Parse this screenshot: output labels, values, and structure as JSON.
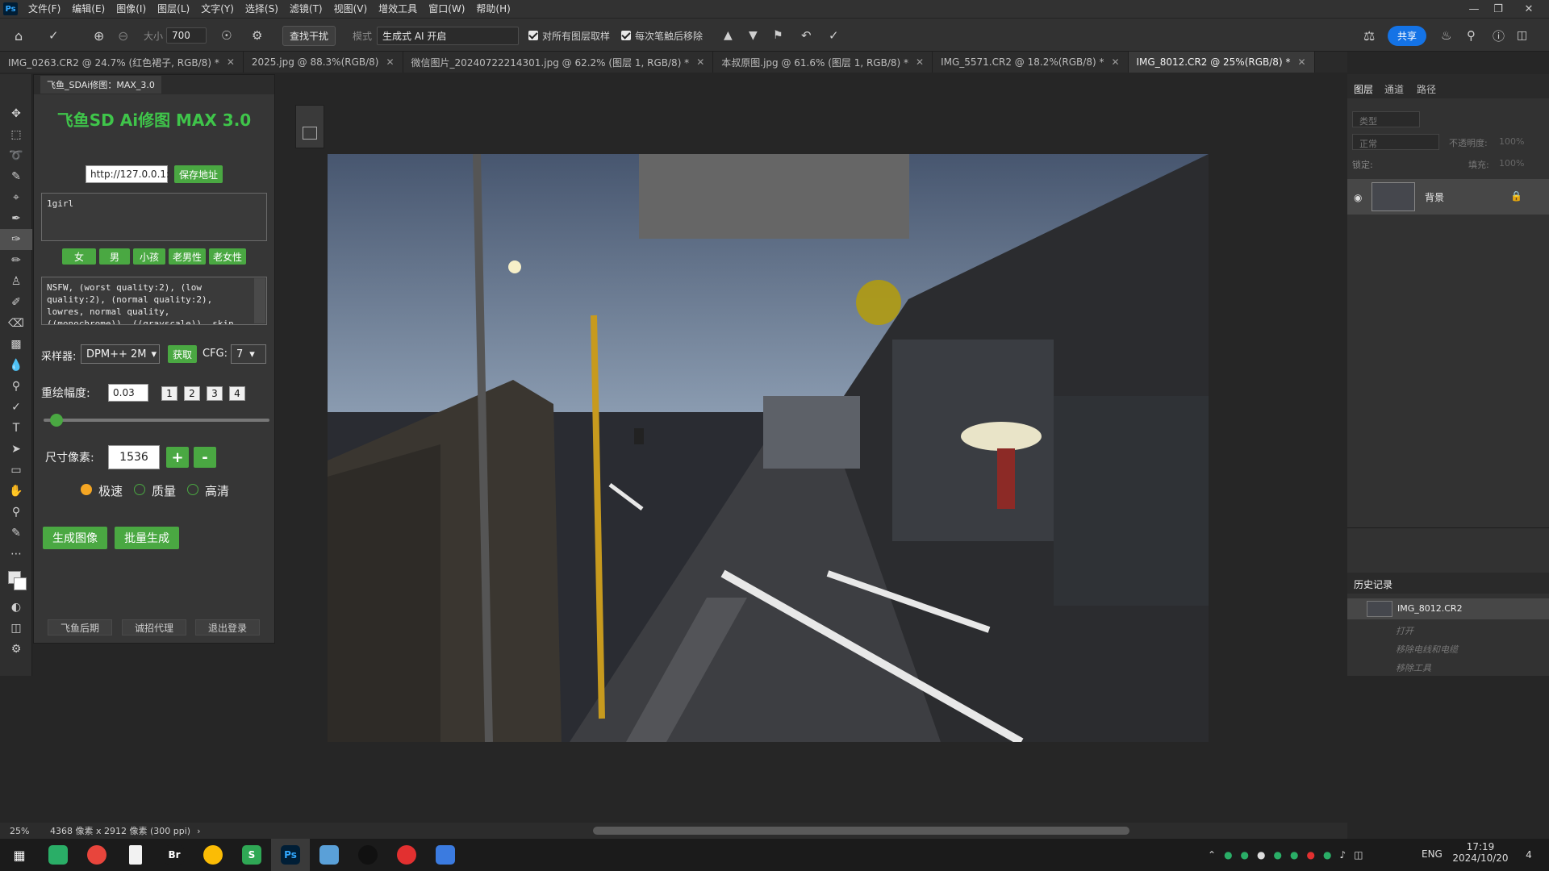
{
  "menubar": {
    "logo": "Ps",
    "items": [
      "文件(F)",
      "编辑(E)",
      "图像(I)",
      "图层(L)",
      "文字(Y)",
      "选择(S)",
      "滤镜(T)",
      "视图(V)",
      "增效工具",
      "窗口(W)",
      "帮助(H)"
    ]
  },
  "options": {
    "size_label": "大小",
    "size_value": "700",
    "find_button": "查找干扰",
    "mode_label": "模式",
    "mode_value": "生成式 AI 开启",
    "sample_all": "对所有图层取样",
    "remove_after": "每次笔触后移除",
    "share": "共享"
  },
  "tabs": [
    {
      "label": "IMG_0263.CR2 @ 24.7% (红色裙子, RGB/8) *",
      "active": false
    },
    {
      "label": "2025.jpg @ 88.3%(RGB/8)",
      "active": false
    },
    {
      "label": "微信图片_20240722214301.jpg @ 62.2% (图层 1, RGB/8) *",
      "active": false
    },
    {
      "label": "本叔原图.jpg @ 61.6% (图层 1, RGB/8) *",
      "active": false
    },
    {
      "label": "IMG_5571.CR2 @ 18.2%(RGB/8) *",
      "active": false
    },
    {
      "label": "IMG_8012.CR2 @ 25%(RGB/8) *",
      "active": true
    }
  ],
  "plugin": {
    "tab": "飞鱼_SDAi修图：MAX_3.0",
    "title": "飞鱼SD Ai修图 MAX 3.0",
    "url": "http://127.0.0.1:",
    "save_url": "保存地址",
    "prompt": "1girl",
    "quick": [
      "女",
      "男",
      "小孩",
      "老男性",
      "老女性"
    ],
    "negative": "NSFW, (worst quality:2), (low quality:2), (normal quality:2), lowres, normal quality, ((monochrome)), ((grayscale)), skin",
    "sampler_label": "采样器:",
    "sampler": "DPM++ 2M",
    "fetch": "获取",
    "cfg_label": "CFG:",
    "cfg": "7",
    "denoise_label": "重绘幅度:",
    "denoise": "0.03",
    "nums": [
      "1",
      "2",
      "3",
      "4"
    ],
    "denoise_level": 0.03,
    "size_label": "尺寸像素:",
    "size": "1536",
    "plus": "+",
    "minus": "-",
    "radios": [
      "极速",
      "质量",
      "高清"
    ],
    "generate": "生成图像",
    "batch": "批量生成",
    "footer": [
      "飞鱼后期",
      "诚招代理",
      "退出登录"
    ]
  },
  "layers": {
    "tabs": [
      "图层",
      "通道",
      "路径"
    ],
    "filter": "类型",
    "blend": "正常",
    "opacity_label": "不透明度:",
    "opacity": "100%",
    "lock_label": "锁定:",
    "fill_label": "填充:",
    "fill": "100%",
    "layer_name": "背景"
  },
  "history": {
    "title": "历史记录",
    "snapshot": "IMG_8012.CR2",
    "items": [
      "打开",
      "移除电线和电缆",
      "移除工具"
    ]
  },
  "status": {
    "zoom": "25%",
    "info": "4368 像素 x 2912 像素 (300 ppi)"
  },
  "taskbar": {
    "apps": [
      {
        "name": "wechat",
        "label": "",
        "color": "#2aae67"
      },
      {
        "name": "chrome",
        "label": "",
        "color": "#e8453c"
      },
      {
        "name": "notepad",
        "label": "",
        "color": "#f2f2f2"
      },
      {
        "name": "bridge",
        "label": "Br",
        "color": "#1b1b1b"
      },
      {
        "name": "chrome2",
        "label": "",
        "color": "#fbbc05"
      },
      {
        "name": "wps",
        "label": "S",
        "color": "#2fa855"
      },
      {
        "name": "photoshop",
        "label": "Ps",
        "color": "#001e36"
      },
      {
        "name": "files",
        "label": "",
        "color": "#5aa0d8"
      },
      {
        "name": "qq",
        "label": "",
        "color": "#ffffff"
      },
      {
        "name": "recorder",
        "label": "",
        "color": "#e23030"
      },
      {
        "name": "network",
        "label": "",
        "color": "#3b7be0"
      }
    ],
    "lang": "ENG",
    "time": "17:19",
    "date": "2024/10/20",
    "notif": "4"
  },
  "colors": {
    "accent": "#1473e6",
    "green": "#4aa842"
  }
}
